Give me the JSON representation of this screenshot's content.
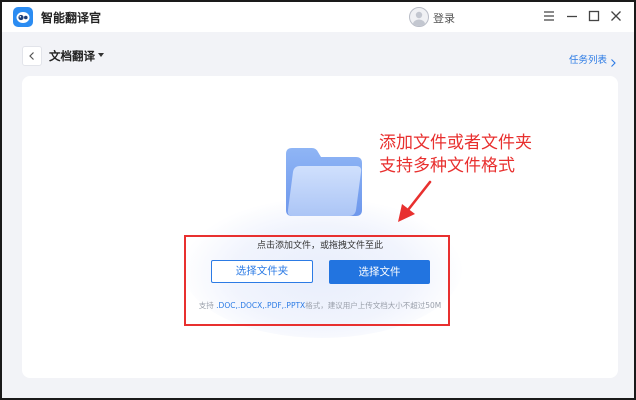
{
  "app": {
    "title": "智能翻译官"
  },
  "header": {
    "login_label": "登录"
  },
  "window_controls": {
    "icons": [
      "menu-icon",
      "minimize-icon",
      "maximize-icon",
      "close-icon"
    ]
  },
  "subheader": {
    "title": "文档翻译",
    "task_list_label": "任务列表"
  },
  "annotation": {
    "line1": "添加文件或者文件夹",
    "line2": "支持多种文件格式"
  },
  "dropzone": {
    "hint": "点击添加文件，或拖拽文件至此",
    "select_folder_label": "选择文件夹",
    "select_file_label": "选择文件",
    "support_prefix": "支持",
    "support_formats": ".DOC,.DOCX,.PDF,.PPTX",
    "support_suffix": "格式，建议用户上传文档大小不超过50M"
  },
  "colors": {
    "accent": "#2274e0",
    "annotation_red": "#e8302f",
    "background": "#f2f3f7"
  }
}
